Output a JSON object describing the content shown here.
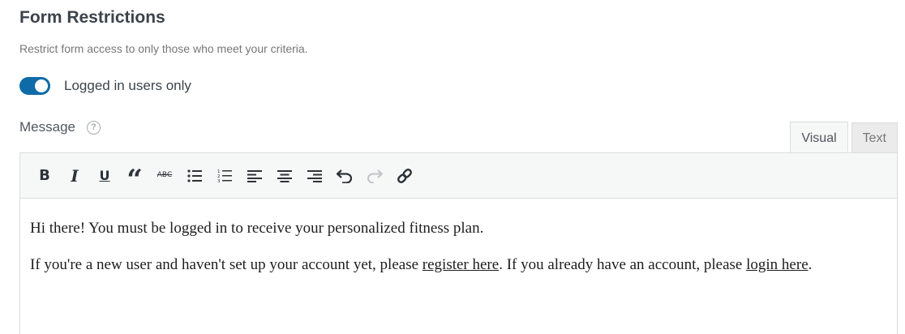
{
  "section": {
    "title": "Form Restrictions",
    "subtitle": "Restrict form access to only those who meet your criteria."
  },
  "toggle": {
    "label": "Logged in users only",
    "state": "on",
    "color": "#0e6ba8"
  },
  "message": {
    "label": "Message",
    "help_icon": "question-circle-icon"
  },
  "editor_tabs": [
    {
      "label": "Visual",
      "active": true
    },
    {
      "label": "Text",
      "active": false
    }
  ],
  "toolbar": {
    "buttons": [
      {
        "name": "bold",
        "icon": "bold-icon",
        "glyph": "B"
      },
      {
        "name": "italic",
        "icon": "italic-icon",
        "glyph": "I"
      },
      {
        "name": "underline",
        "icon": "underline-icon",
        "glyph": "U"
      },
      {
        "name": "blockquote",
        "icon": "blockquote-icon",
        "glyph": "“"
      },
      {
        "name": "strikethrough",
        "icon": "strikethrough-icon",
        "glyph": "ABC"
      },
      {
        "name": "bullet-list",
        "icon": "bullet-list-icon"
      },
      {
        "name": "numbered-list",
        "icon": "numbered-list-icon"
      },
      {
        "name": "align-left",
        "icon": "align-left-icon"
      },
      {
        "name": "align-center",
        "icon": "align-center-icon"
      },
      {
        "name": "align-right",
        "icon": "align-right-icon"
      },
      {
        "name": "undo",
        "icon": "undo-icon"
      },
      {
        "name": "redo",
        "icon": "redo-icon",
        "disabled": true
      },
      {
        "name": "link",
        "icon": "link-icon"
      }
    ]
  },
  "content": {
    "p1": "Hi there! You must be logged in to receive your personalized fitness plan.",
    "p2_before": "If you're a new user and haven't set up your account yet, please ",
    "p2_link1": "register here",
    "p2_middle": ". If you already have an account, please ",
    "p2_link2": "login here",
    "p2_end": "."
  }
}
